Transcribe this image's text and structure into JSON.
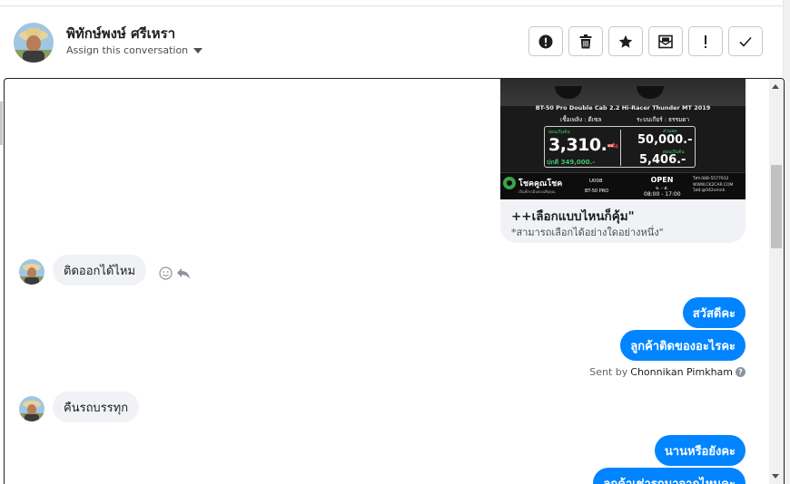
{
  "header": {
    "contact_name": "พิทักษ์พงษ์ ศรีเหรา",
    "assign_label": "Assign this conversation"
  },
  "actions": [
    {
      "name": "mark-spam-button",
      "icon": "exclamation-circle-icon"
    },
    {
      "name": "delete-button",
      "icon": "trash-icon"
    },
    {
      "name": "star-button",
      "icon": "star-icon"
    },
    {
      "name": "mark-unread-button",
      "icon": "envelope-icon"
    },
    {
      "name": "follow-up-button",
      "icon": "exclamation-icon"
    },
    {
      "name": "mark-done-button",
      "icon": "checkmark-icon"
    }
  ],
  "promo_card": {
    "image": {
      "model_line": "BT-50 Pro Double Cab 2.2 Hi-Racer Thunder MT 2019",
      "fuel": "เชื้อเพลิง : ดีเซล",
      "gear": "ระบบเกียร์ : ธรรมดา",
      "down_label": "ผ่อนเริ่มต้น",
      "monthly_price": "3,310.-",
      "or_text": "หรือ",
      "normal_price": "ปกติ 349,000.-",
      "discount_label": "ส่วนลด",
      "discount": "50,000.-",
      "second_label": "ผ่อนเริ่มต้น",
      "second_price": "5,406.-",
      "brand_name": "โชคคูณโชค",
      "brand_tagline": "เป็นทั้งรถมือสองเพื่อคุณ",
      "code": "U008",
      "model_short": "BT-50 PRO",
      "open": "OPEN",
      "days": "จ. - ส.",
      "hours": "08:00 - 17:00",
      "contact_lines": [
        "โทร.088-5577932",
        "WWW.CK2CAR.COM",
        "ไลน์:@042vmnh"
      ]
    },
    "title": "++เลือกแบบไหนก็คุ้ม\"",
    "subtitle": "*สามารถเลือกได้อย่างใดอย่างหนึ่ง\""
  },
  "messages": {
    "in_1": "ติดออกได้ไหม",
    "out_1": "สวัสดีคะ",
    "out_2": "ลูกค้าติดของอะไรคะ",
    "sent_by_prefix": "Sent by",
    "sent_by_name": "Chonnikan Pimkham",
    "in_2": "คืนรถบรรทุก",
    "out_3": "นานหรือยังคะ",
    "out_4": "ลูกค้าเช่ารถมาจากไหนคะ"
  },
  "colors": {
    "outgoing_bubble": "#0084ff",
    "incoming_bubble": "#f0f2f5",
    "price_green": "#3ec46d"
  }
}
